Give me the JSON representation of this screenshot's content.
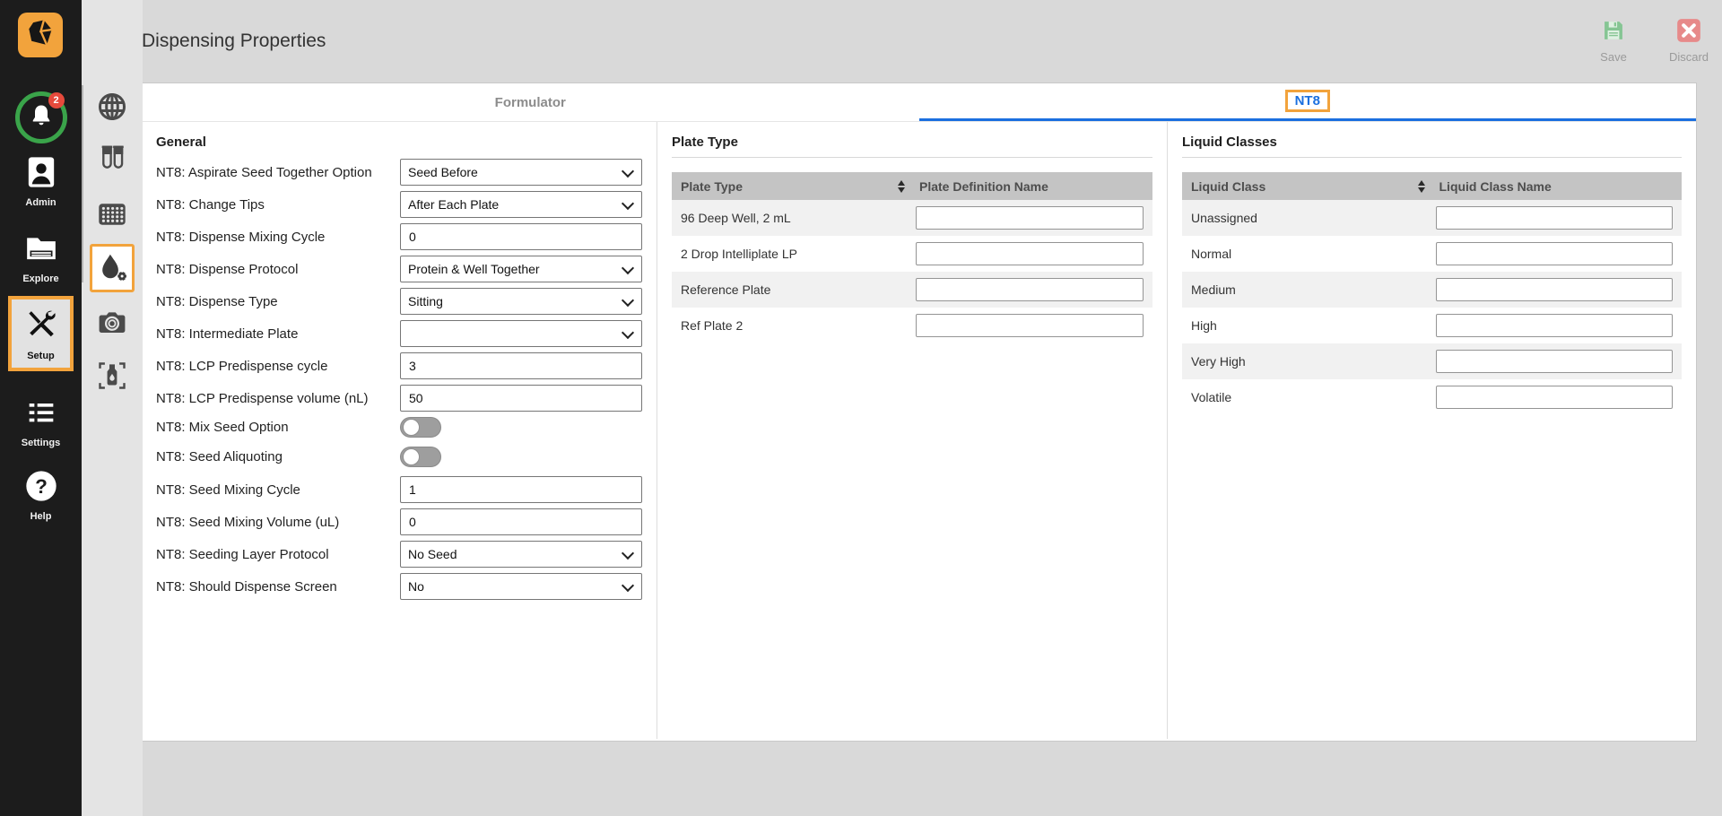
{
  "app": {
    "title": "Dispensing Properties"
  },
  "actions": {
    "save": "Save",
    "discard": "Discard"
  },
  "colors": {
    "accent_orange": "#F2A33C",
    "tab_active_blue": "#1A6FDF",
    "save_green": "#85C593",
    "discard_red": "#E78A8A",
    "notification_ring_green": "#3AA44A",
    "notification_badge_red": "#E64A3C",
    "table_header_gray": "#C4C4C4"
  },
  "sidebar": {
    "notification_badge": "2",
    "items": [
      {
        "label": "Admin",
        "icon": "user-badge-icon",
        "selected": false
      },
      {
        "label": "Explore",
        "icon": "folder-icon",
        "selected": false
      },
      {
        "label": "Setup",
        "icon": "tools-icon",
        "selected": true
      },
      {
        "label": "Settings",
        "icon": "list-icon",
        "selected": false
      },
      {
        "label": "Help",
        "icon": "help-icon",
        "selected": false
      }
    ]
  },
  "substrip": {
    "icons": [
      {
        "name": "globe-icon",
        "selected": false
      },
      {
        "name": "test-tubes-icon",
        "selected": false
      },
      {
        "name": "plate-grid-icon",
        "selected": false
      },
      {
        "name": "dispense-droplet-gear-icon",
        "selected": true
      },
      {
        "name": "camera-icon",
        "selected": false
      },
      {
        "name": "bottle-icon",
        "selected": false
      }
    ]
  },
  "tabs": [
    {
      "label": "Formulator",
      "active": false
    },
    {
      "label": "NT8",
      "active": true
    }
  ],
  "general": {
    "heading": "General",
    "rows": [
      {
        "label": "NT8: Aspirate Seed Together Option",
        "type": "select",
        "value": "Seed Before"
      },
      {
        "label": "NT8: Change Tips",
        "type": "select",
        "value": "After Each Plate"
      },
      {
        "label": "NT8: Dispense Mixing Cycle",
        "type": "input",
        "value": "0"
      },
      {
        "label": "NT8: Dispense Protocol",
        "type": "select",
        "value": "Protein & Well Together"
      },
      {
        "label": "NT8: Dispense Type",
        "type": "select",
        "value": "Sitting"
      },
      {
        "label": "NT8: Intermediate Plate",
        "type": "select",
        "value": ""
      },
      {
        "label": "NT8: LCP Predispense cycle",
        "type": "input",
        "value": "3"
      },
      {
        "label": "NT8: LCP Predispense volume (nL)",
        "type": "input",
        "value": "50"
      },
      {
        "label": "NT8: Mix Seed Option",
        "type": "toggle",
        "value": "off"
      },
      {
        "label": "NT8: Seed Aliquoting",
        "type": "toggle",
        "value": "off"
      },
      {
        "label": "NT8: Seed Mixing Cycle",
        "type": "input",
        "value": "1"
      },
      {
        "label": "NT8: Seed Mixing Volume (uL)",
        "type": "input",
        "value": "0"
      },
      {
        "label": "NT8: Seeding Layer Protocol",
        "type": "select",
        "value": "No Seed"
      },
      {
        "label": "NT8: Should Dispense Screen",
        "type": "select",
        "value": "No"
      }
    ]
  },
  "plate_type": {
    "heading": "Plate Type",
    "columns": [
      "Plate Type",
      "Plate Definition Name"
    ],
    "rows": [
      {
        "name": "96 Deep Well, 2 mL",
        "value": ""
      },
      {
        "name": "2 Drop Intelliplate LP",
        "value": ""
      },
      {
        "name": "Reference Plate",
        "value": ""
      },
      {
        "name": "Ref Plate 2",
        "value": ""
      }
    ]
  },
  "liquid_classes": {
    "heading": "Liquid Classes",
    "columns": [
      "Liquid Class",
      "Liquid Class Name"
    ],
    "rows": [
      {
        "name": "Unassigned",
        "value": ""
      },
      {
        "name": "Normal",
        "value": ""
      },
      {
        "name": "Medium",
        "value": ""
      },
      {
        "name": "High",
        "value": ""
      },
      {
        "name": "Very High",
        "value": ""
      },
      {
        "name": "Volatile",
        "value": ""
      }
    ]
  }
}
